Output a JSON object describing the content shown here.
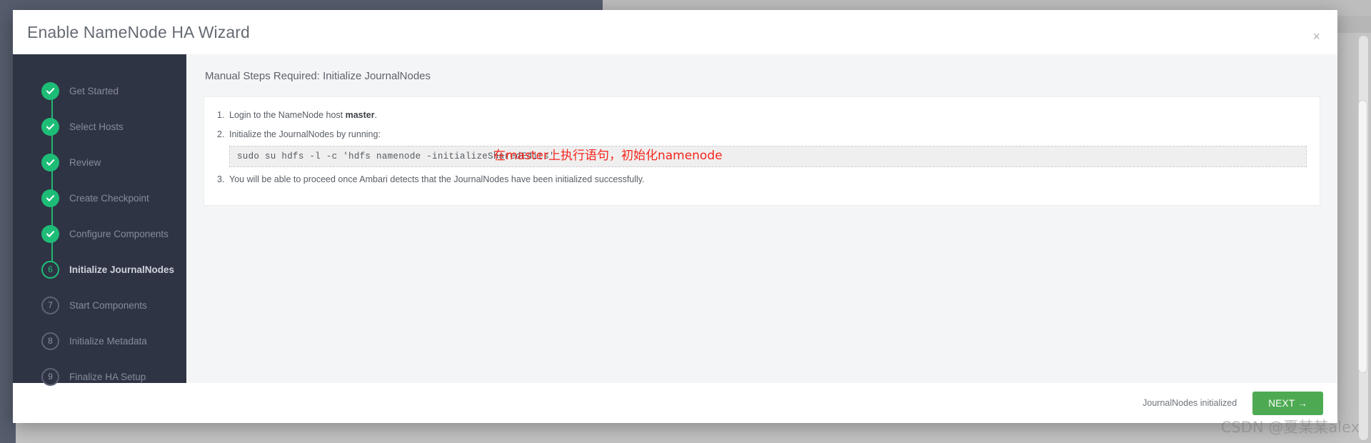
{
  "modal": {
    "title": "Enable NameNode HA Wizard",
    "close_label": "×"
  },
  "wizard_steps": [
    {
      "index": "1",
      "label": "Get Started",
      "state": "done"
    },
    {
      "index": "2",
      "label": "Select Hosts",
      "state": "done"
    },
    {
      "index": "3",
      "label": "Review",
      "state": "done"
    },
    {
      "index": "4",
      "label": "Create Checkpoint",
      "state": "done"
    },
    {
      "index": "5",
      "label": "Configure Components",
      "state": "done"
    },
    {
      "index": "6",
      "label": "Initialize JournalNodes",
      "state": "active"
    },
    {
      "index": "7",
      "label": "Start Components",
      "state": "pending"
    },
    {
      "index": "8",
      "label": "Initialize Metadata",
      "state": "pending"
    },
    {
      "index": "9",
      "label": "Finalize HA Setup",
      "state": "pending"
    }
  ],
  "content": {
    "title": "Manual Steps Required: Initialize JournalNodes",
    "items": [
      {
        "num": "1.",
        "text_before": "Login to the NameNode host ",
        "bold": "master",
        "text_after": "."
      },
      {
        "num": "2.",
        "text_before": "Initialize the JournalNodes by running:",
        "bold": "",
        "text_after": ""
      },
      {
        "num": "3.",
        "text_before": "You will be able to proceed once Ambari detects that the JournalNodes have been initialized successfully.",
        "bold": "",
        "text_after": ""
      }
    ],
    "command": "sudo su hdfs -l -c 'hdfs namenode -initializeSharedEdits'",
    "annotation": "在master上执行语句，初始化namenode"
  },
  "footer": {
    "status": "JournalNodes initialized",
    "next_label": "NEXT →"
  },
  "watermark": "CSDN @夏某某alex",
  "colors": {
    "accent_green": "#1ebd77",
    "button_green": "#4eaa52",
    "sidebar_dark": "#2f3444",
    "annotation_red": "#f6261e"
  }
}
